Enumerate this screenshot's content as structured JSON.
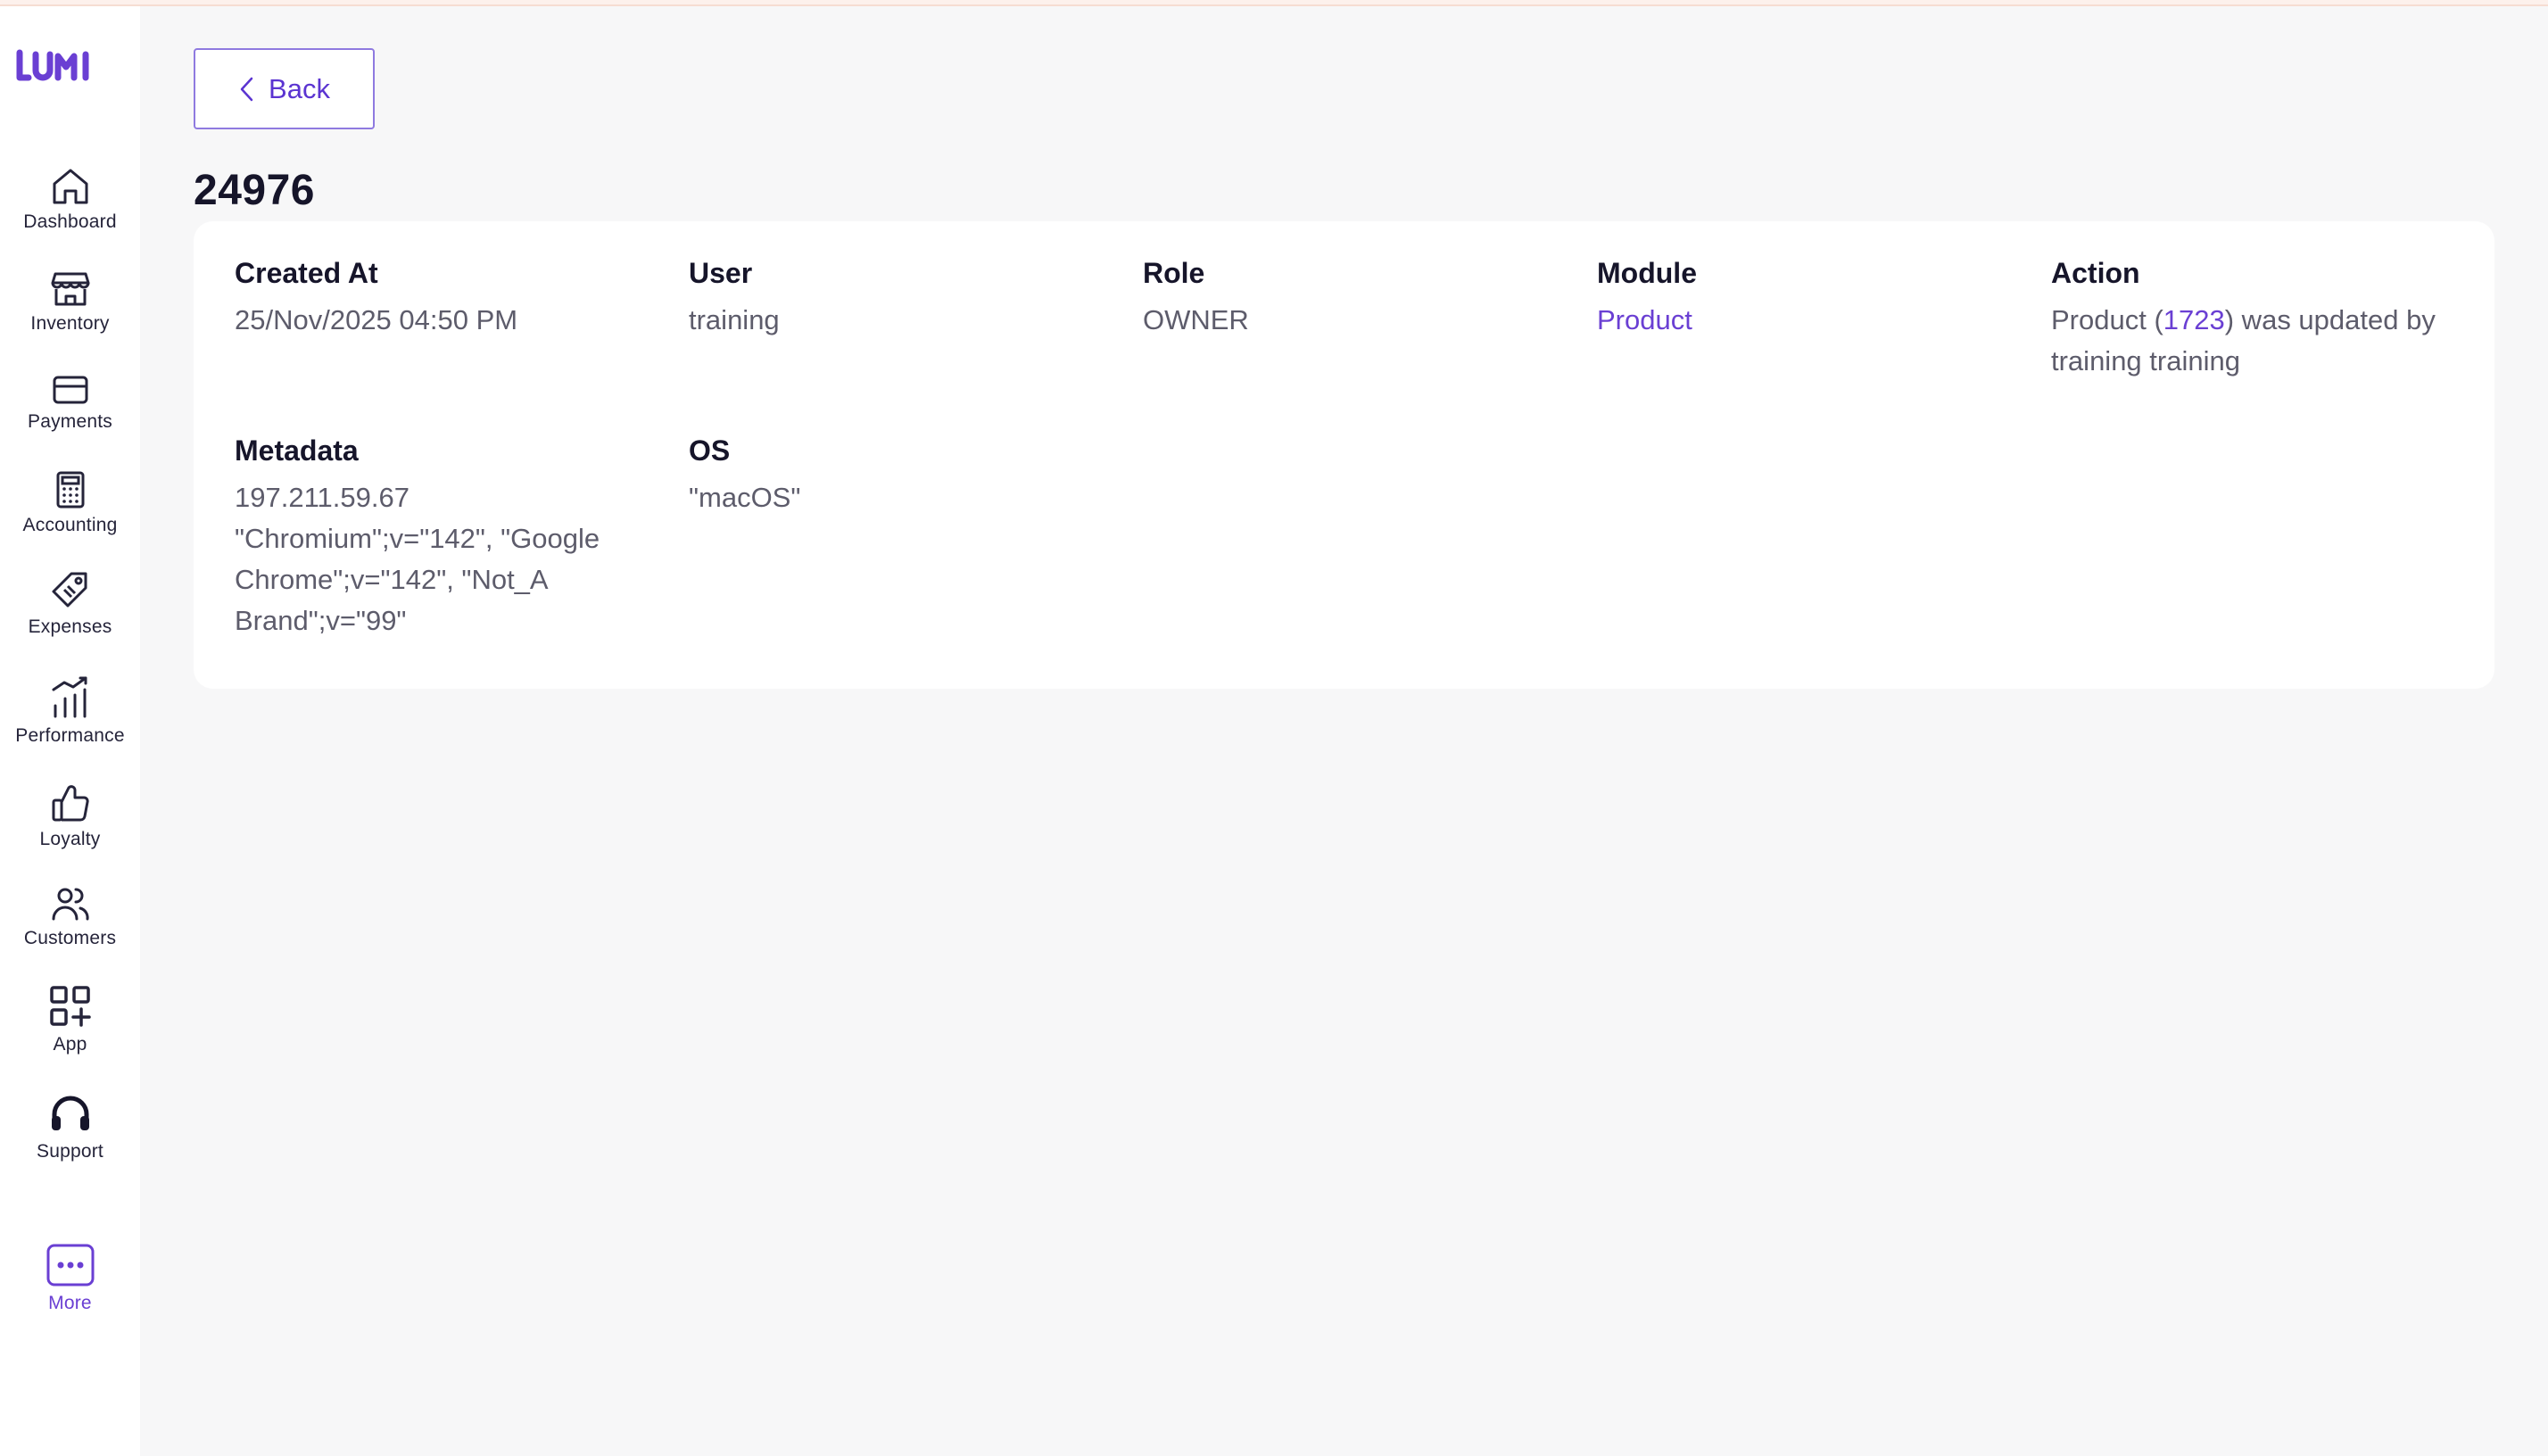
{
  "app": {
    "logo_text": "LUMI",
    "brand_color": "#6a3fd3"
  },
  "sidebar": {
    "items": [
      {
        "label": "Dashboard",
        "icon": "home-icon"
      },
      {
        "label": "Inventory",
        "icon": "store-icon"
      },
      {
        "label": "Payments",
        "icon": "credit-card-icon"
      },
      {
        "label": "Accounting",
        "icon": "calculator-icon"
      },
      {
        "label": "Expenses",
        "icon": "tag-icon"
      },
      {
        "label": "Performance",
        "icon": "trend-chart-icon"
      },
      {
        "label": "Loyalty",
        "icon": "thumbs-up-icon"
      },
      {
        "label": "Customers",
        "icon": "users-icon"
      },
      {
        "label": "App",
        "icon": "apps-grid-icon"
      },
      {
        "label": "Support",
        "icon": "headset-icon"
      },
      {
        "label": "More",
        "icon": "more-dots-icon"
      }
    ]
  },
  "header": {
    "back_label": "Back",
    "title": "24976"
  },
  "details": {
    "created_at": {
      "label": "Created At",
      "value": "25/Nov/2025 04:50 PM"
    },
    "user": {
      "label": "User",
      "value": "training"
    },
    "role": {
      "label": "Role",
      "value": "OWNER"
    },
    "module": {
      "label": "Module",
      "value": "Product"
    },
    "action": {
      "label": "Action",
      "prefix": "Product (",
      "link": "1723",
      "suffix": ") was updated by training training"
    },
    "metadata": {
      "label": "Metadata",
      "ip": "197.211.59.67",
      "user_agent": "\"Chromium\";v=\"142\", \"Google Chrome\";v=\"142\", \"Not_A Brand\";v=\"99\""
    },
    "os": {
      "label": "OS",
      "value": "\"macOS\""
    }
  }
}
